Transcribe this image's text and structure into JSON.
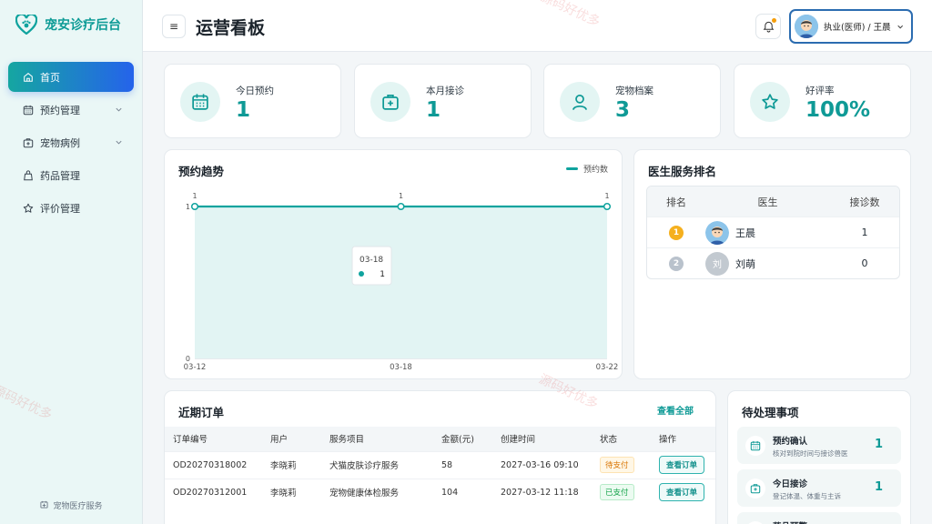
{
  "app": {
    "name": "宠安诊疗后台",
    "footer": "宠物医疗服务"
  },
  "sidebar": {
    "items": [
      {
        "label": "首页",
        "active": true,
        "icon": "home-icon",
        "expandable": false
      },
      {
        "label": "预约管理",
        "active": false,
        "icon": "calendar-icon",
        "expandable": true
      },
      {
        "label": "宠物病例",
        "active": false,
        "icon": "medical-case-icon",
        "expandable": true
      },
      {
        "label": "药品管理",
        "active": false,
        "icon": "medicine-bag-icon",
        "expandable": false
      },
      {
        "label": "评价管理",
        "active": false,
        "icon": "star-icon",
        "expandable": false
      }
    ]
  },
  "header": {
    "menu_glyph": "≡",
    "title": "运营看板",
    "user": {
      "name": "执业(医师) / 王晨"
    }
  },
  "stats": [
    {
      "label": "今日预约",
      "value": "1",
      "icon": "calendar-icon"
    },
    {
      "label": "本月接诊",
      "value": "1",
      "icon": "medical-kit-icon"
    },
    {
      "label": "宠物档案",
      "value": "3",
      "icon": "user-icon"
    },
    {
      "label": "好评率",
      "value": "100%",
      "icon": "star-icon"
    }
  ],
  "trend": {
    "title": "预约趋势"
  },
  "chart_data": {
    "type": "area",
    "x": [
      "03-12",
      "03-18",
      "03-22"
    ],
    "series": [
      {
        "name": "预约数",
        "values": [
          1,
          1,
          1
        ]
      }
    ],
    "ylim": [
      0,
      1
    ],
    "yticks": [
      0,
      1
    ],
    "data_labels": true,
    "legend": "top-right",
    "tooltip": {
      "x": "03-18",
      "value": "1"
    },
    "colors": {
      "line": "#0fa39e",
      "fill": "#e2f4f3"
    }
  },
  "ranking": {
    "title": "医生服务排名",
    "columns": [
      "排名",
      "医生",
      "接诊数"
    ],
    "rows": [
      {
        "rank": "1",
        "name": "王晨",
        "count": "1",
        "badge_color": "#f5b01e",
        "avatar": "cartoon-avatar-icon"
      },
      {
        "rank": "2",
        "name": "刘萌",
        "count": "0",
        "badge_color": "#b9c2cc",
        "avatar_text": "刘"
      }
    ]
  },
  "orders": {
    "title": "近期订单",
    "view_all": "查看全部",
    "columns": [
      "订单编号",
      "用户",
      "服务项目",
      "金额(元)",
      "创建时间",
      "状态",
      "操作"
    ],
    "rows": [
      {
        "id": "OD20270318002",
        "user": "李晓莉",
        "service": "犬猫皮肤诊疗服务",
        "amount": "58",
        "time": "2027-03-16 09:10",
        "status": "待支付",
        "status_type": "unpaid",
        "action": "查看订单"
      },
      {
        "id": "OD20270312001",
        "user": "李晓莉",
        "service": "宠物健康体检服务",
        "amount": "104",
        "time": "2027-03-12 11:18",
        "status": "已支付",
        "status_type": "paid",
        "action": "查看订单"
      }
    ]
  },
  "todos": {
    "title": "待处理事项",
    "items": [
      {
        "title": "预约确认",
        "sub": "核对到院时间与接诊兽医",
        "count": "1",
        "icon": "calendar-icon"
      },
      {
        "title": "今日接诊",
        "sub": "登记体温、体重与主诉",
        "count": "1",
        "icon": "medical-kit-icon"
      },
      {
        "title": "药品预警",
        "sub": "",
        "count": "",
        "icon": "medicine-bag-icon"
      }
    ]
  },
  "watermark": "源码好优多"
}
